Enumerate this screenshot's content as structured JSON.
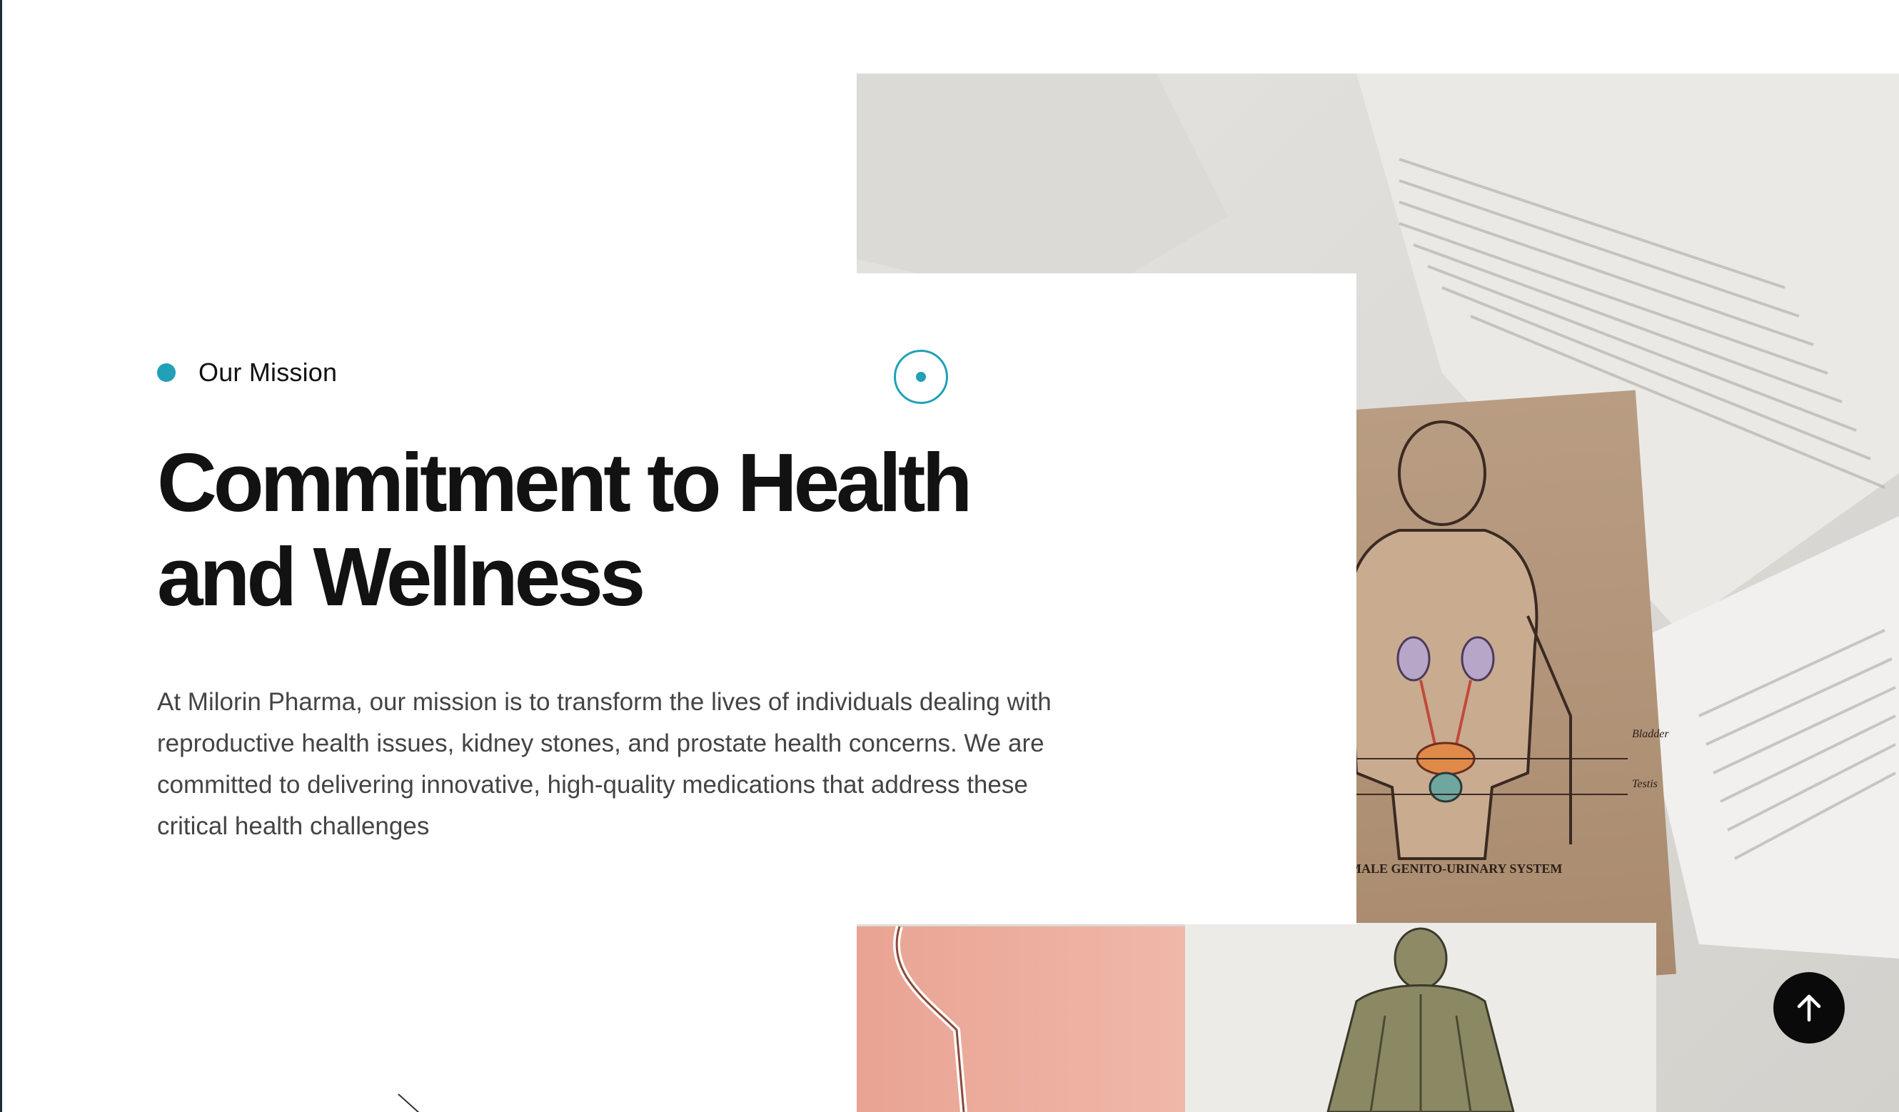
{
  "mission": {
    "eyebrow": "Our Mission",
    "heading_line1": "Commitment to Health",
    "heading_line2": "and Wellness",
    "body": "At Milorin Pharma, our mission is to transform the lives of individuals dealing with reproductive health issues, kidney stones, and prostate health concerns. We are committed to delivering innovative, high-quality medications that address these critical health challenges"
  },
  "photo": {
    "caption": "MALE GENITO-URINARY SYSTEM",
    "label_bladder": "Bladder",
    "label_testis": "Testis"
  },
  "icons": {
    "target": "target-icon",
    "scroll_top": "arrow-up-icon"
  },
  "colors": {
    "accent": "#22a0b8",
    "heading": "#121212",
    "body": "#444444",
    "button": "#0a0a0a"
  }
}
